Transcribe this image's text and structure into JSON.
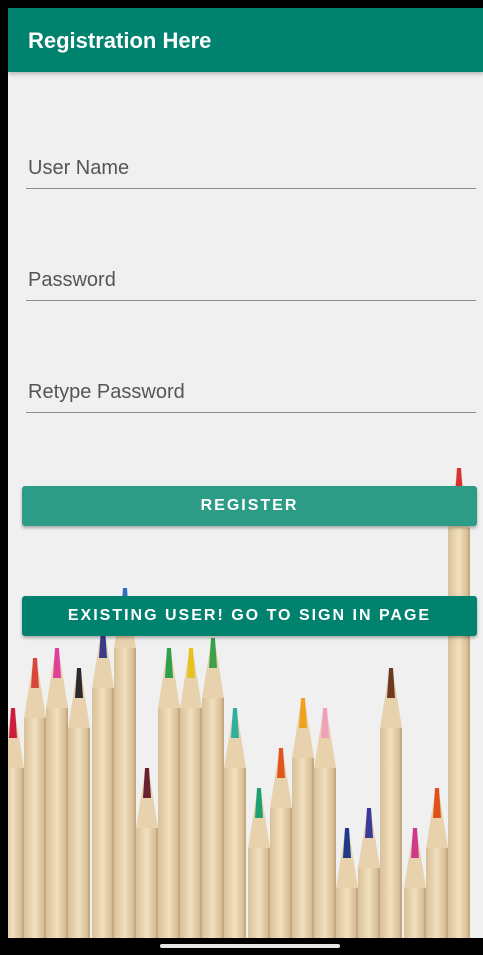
{
  "appbar": {
    "title": "Registration Here"
  },
  "form": {
    "username_placeholder": "User Name",
    "password_placeholder": "Password",
    "retype_placeholder": "Retype Password",
    "register_label": "REGISTER",
    "signin_label": "EXISTING USER! GO TO SIGN IN PAGE"
  },
  "colors": {
    "appbar": "#00826f",
    "register_button": "#2d9c87",
    "signin_button": "#00826f",
    "background": "#f0f0f0"
  }
}
